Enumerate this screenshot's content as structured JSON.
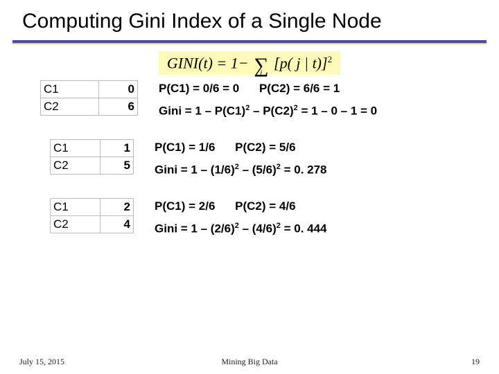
{
  "title": "Computing Gini Index of a Single Node",
  "formula": {
    "lhs": "GINI(t)",
    "eq": "=",
    "one_minus": "1−",
    "sigma_sub": "j",
    "body_open": "[",
    "body": "p( j | t)",
    "body_close": "]",
    "exp": "2"
  },
  "examples": [
    {
      "table": {
        "r1": {
          "label": "C1",
          "value": "0"
        },
        "r2": {
          "label": "C2",
          "value": "6"
        }
      },
      "pc1": "P(C1) = 0/6 = 0",
      "pc2": "P(C2) = 6/6 = 1",
      "gini_pre": "Gini = 1 – P(C1)",
      "gini_mid": " – P(C2)",
      "gini_post": " = 1 – 0 – 1 = 0"
    },
    {
      "table": {
        "r1": {
          "label": "C1",
          "value": "1"
        },
        "r2": {
          "label": "C2",
          "value": "5"
        }
      },
      "pc1": "P(C1) = 1/6",
      "pc2": "P(C2) = 5/6",
      "gini_pre": "Gini = 1 – (1/6)",
      "gini_mid": " – (5/6)",
      "gini_post": " = 0. 278"
    },
    {
      "table": {
        "r1": {
          "label": "C1",
          "value": "2"
        },
        "r2": {
          "label": "C2",
          "value": "4"
        }
      },
      "pc1": "P(C1) = 2/6",
      "pc2": "P(C2) = 4/6",
      "gini_pre": "Gini = 1 – (2/6)",
      "gini_mid": " – (4/6)",
      "gini_post": " = 0. 444"
    }
  ],
  "footer": {
    "date": "July 15, 2015",
    "center": "Mining Big Data",
    "page": "19"
  },
  "sup2": "2"
}
